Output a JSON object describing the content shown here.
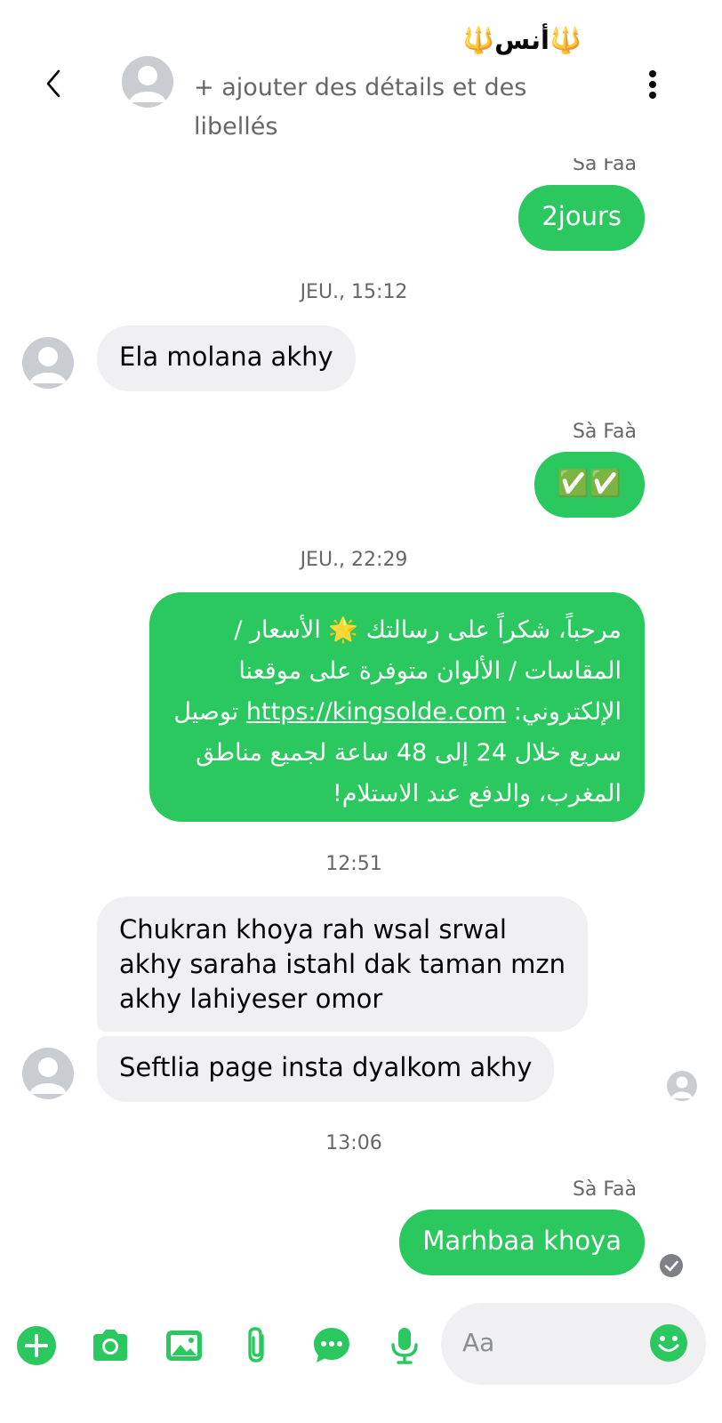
{
  "header": {
    "title": "🔱أنس🔱",
    "subtitle": "+ ajouter des détails et des libellés"
  },
  "messages": {
    "partial_sender": "Sà Faà",
    "m1": "2jours",
    "t1": "JEU., 15:12",
    "m2": "Ela molana akhy",
    "sender2": "Sà Faà",
    "m3": "✅✅",
    "t2": "JEU., 22:29",
    "m4_text": "مرحباً، شكراً على رسالتك 🌟 الأسعار / المقاسات / الألوان متوفرة على موقعنا الإلكتروني: ",
    "m4_link": "https://kingsolde.com",
    "m4_tail": " توصيل سريع خلال 24 إلى 48 ساعة لجميع مناطق المغرب، والدفع عند الاستلام!",
    "t3": "12:51",
    "m5_line1": "Chukran khoya rah wsal srwal",
    "m5_line2": "akhy saraha istahl dak taman mzn",
    "m5_line3": "akhy lahiyeser omor",
    "m6": "Seftlia page insta dyalkom akhy",
    "t4": "13:06",
    "sender3": "Sà Faà",
    "m7": "Marhbaa khoya"
  },
  "composer": {
    "placeholder": "Aa"
  },
  "colors": {
    "accent": "#2ac85f",
    "incoming": "#f0f0f2",
    "muted": "#65676b"
  },
  "icons": [
    "back-icon",
    "more-icon",
    "plus-icon",
    "camera-icon",
    "gallery-icon",
    "attachment-icon",
    "chat-bubble-icon",
    "microphone-icon",
    "emoji-icon",
    "read-receipt-icon"
  ]
}
